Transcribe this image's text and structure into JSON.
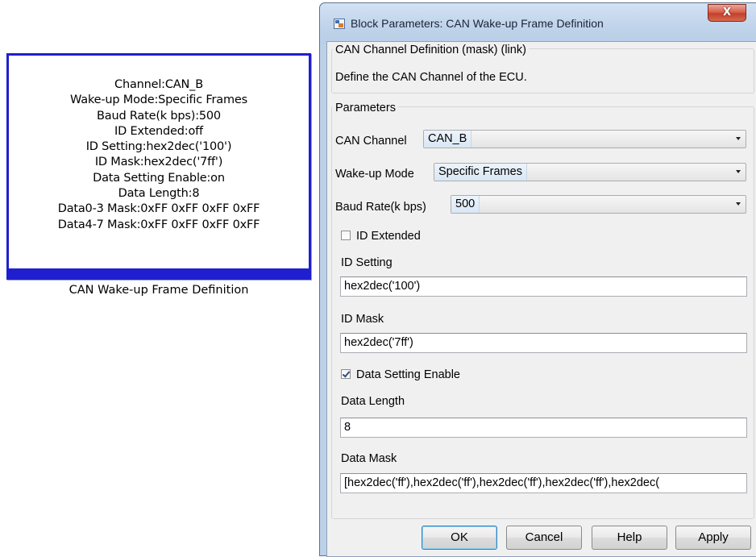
{
  "block": {
    "lines": [
      "Channel:CAN_B",
      "Wake-up Mode:Specific Frames",
      "Baud Rate(k bps):500",
      "ID Extended:off",
      "ID Setting:hex2dec('100')",
      "ID Mask:hex2dec('7ff')",
      "Data Setting Enable:on",
      "Data Length:8",
      "Data0-3 Mask:0xFF 0xFF 0xFF 0xFF",
      "Data4-7 Mask:0xFF 0xFF 0xFF 0xFF"
    ],
    "caption": "CAN Wake-up Frame Definition"
  },
  "dialog": {
    "title": "Block Parameters: CAN Wake-up Frame Definition",
    "close_label": "X",
    "description_group": {
      "title": "CAN Channel Definition (mask) (link)",
      "text": "Define the CAN Channel of the ECU."
    },
    "parameters_group_title": "Parameters",
    "can_channel": {
      "label": "CAN Channel",
      "value": "CAN_B"
    },
    "wakeup_mode": {
      "label": "Wake-up Mode",
      "value": "Specific Frames"
    },
    "baud_rate": {
      "label": "Baud Rate(k bps)",
      "value": "500"
    },
    "id_extended": {
      "label": "ID Extended",
      "checked": false
    },
    "id_setting": {
      "label": "ID Setting",
      "value": "hex2dec('100')"
    },
    "id_mask": {
      "label": "ID Mask",
      "value": "hex2dec('7ff')"
    },
    "data_setting_enable": {
      "label": "Data Setting Enable",
      "checked": true
    },
    "data_length": {
      "label": "Data Length",
      "value": "8"
    },
    "data_mask": {
      "label": "Data Mask",
      "value": "[hex2dec('ff'),hex2dec('ff'),hex2dec('ff'),hex2dec('ff'),hex2dec("
    },
    "buttons": {
      "ok": "OK",
      "cancel": "Cancel",
      "help": "Help",
      "apply": "Apply"
    }
  },
  "colors": {
    "block_border": "#1f1fcf",
    "titlebar": "#bfd3ea",
    "close_button": "#c4402a",
    "dialog_body": "#f0f0f0"
  }
}
